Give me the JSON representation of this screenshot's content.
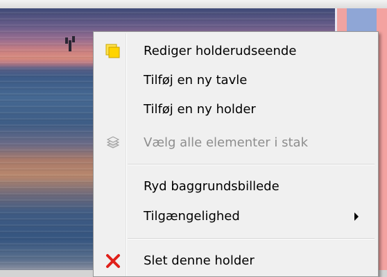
{
  "context_menu": {
    "items": [
      {
        "label": "Rediger holderudseende",
        "icon": "note-icon",
        "enabled": true
      },
      {
        "label": "Tilføj en ny tavle",
        "icon": "",
        "enabled": true
      },
      {
        "label": "Tilføj en ny holder",
        "icon": "",
        "enabled": true
      },
      {
        "label": "Vælg alle elementer i stak",
        "icon": "stack-icon",
        "enabled": false
      },
      {
        "label": "Ryd baggrundsbillede",
        "icon": "",
        "enabled": true
      },
      {
        "label": "Tilgængelighed",
        "icon": "",
        "enabled": true,
        "submenu_arrow": "submenu-arrow-icon"
      },
      {
        "label": "Slet denne holder",
        "icon": "delete-icon",
        "enabled": true
      }
    ]
  },
  "colors": {
    "menu_background": "#f0f0f0",
    "menu_border": "#979797",
    "disabled_text": "#8d8d8d",
    "delete_icon": "#e0201a",
    "note_icon": "#ffd400",
    "frame_pink": "#f0a3a1",
    "frame_blue": "#8fa6d6"
  }
}
